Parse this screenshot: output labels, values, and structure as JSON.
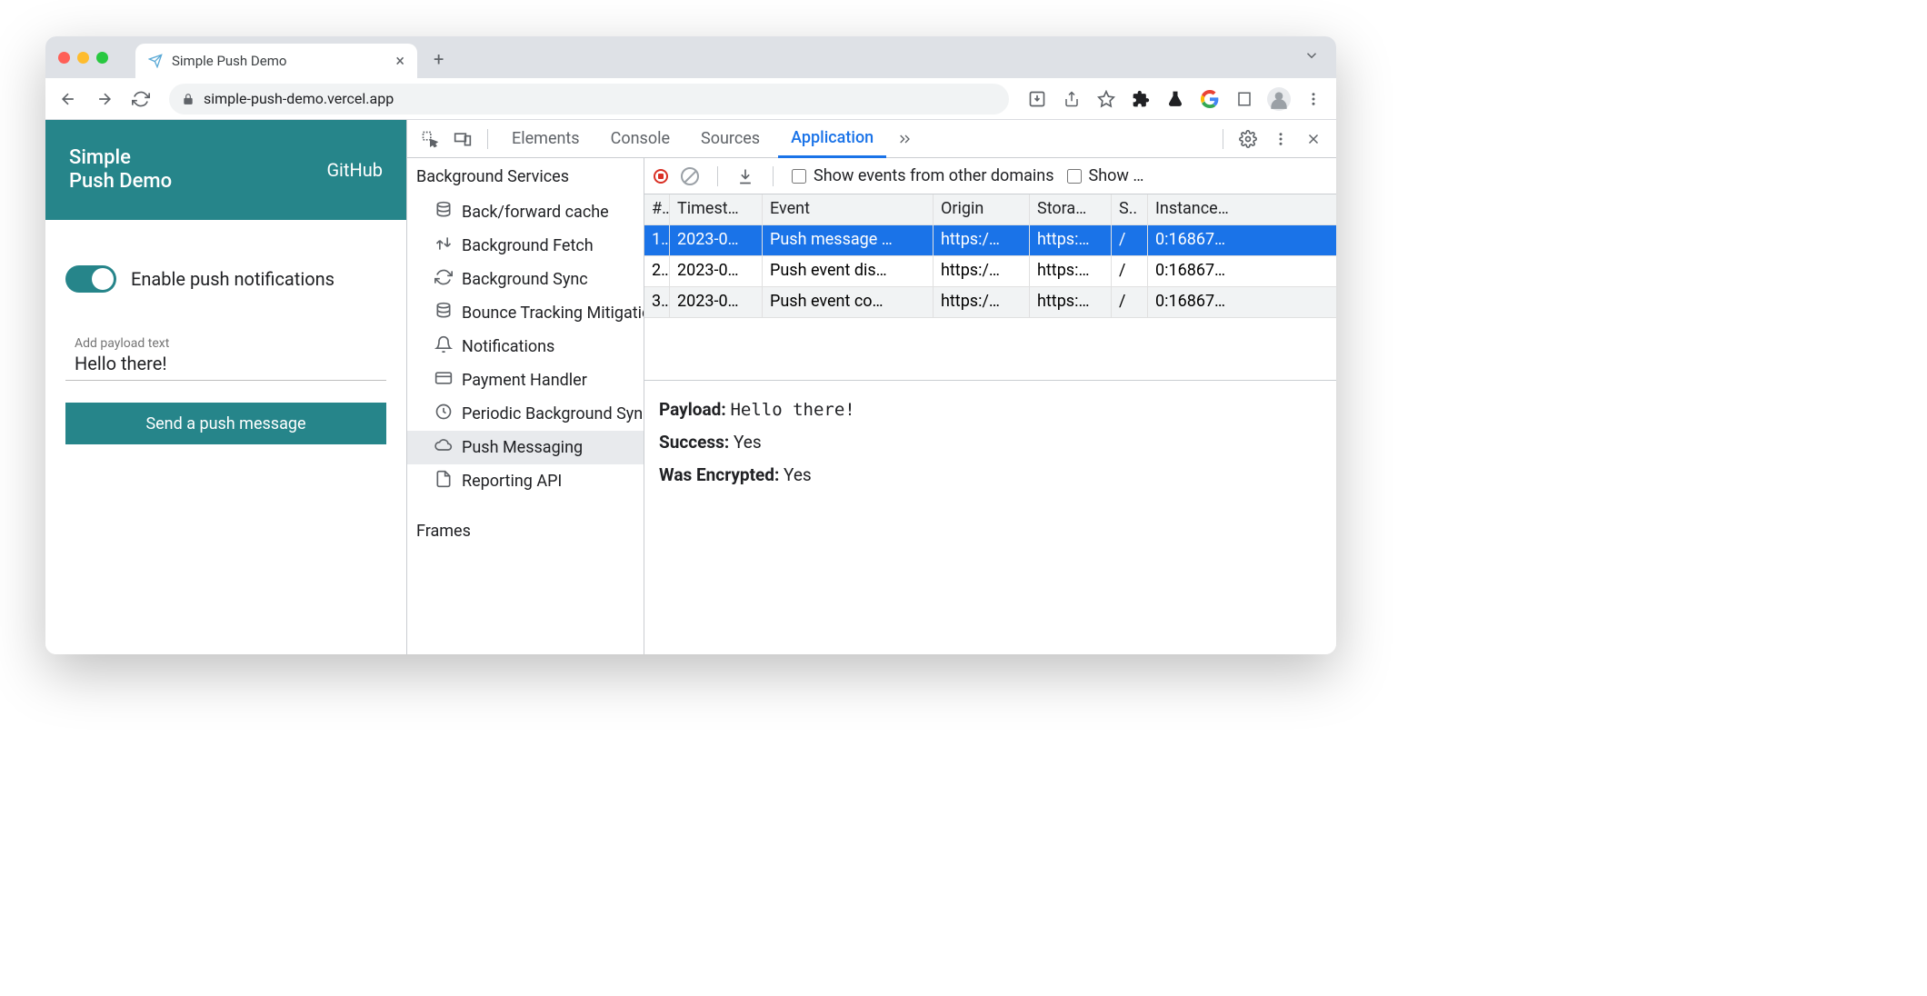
{
  "browser": {
    "tab_title": "Simple Push Demo",
    "url": "simple-push-demo.vercel.app"
  },
  "page": {
    "title_line1": "Simple",
    "title_line2": "Push Demo",
    "github_link": "GitHub",
    "toggle_label": "Enable push notifications",
    "toggle_on": true,
    "payload_label": "Add payload text",
    "payload_value": "Hello there!",
    "send_button": "Send a push message"
  },
  "devtools": {
    "tabs": [
      "Elements",
      "Console",
      "Sources",
      "Application"
    ],
    "active_tab": "Application",
    "sidebar": {
      "group": "Background Services",
      "items": [
        {
          "icon": "db",
          "label": "Back/forward cache"
        },
        {
          "icon": "updown",
          "label": "Background Fetch"
        },
        {
          "icon": "sync",
          "label": "Background Sync"
        },
        {
          "icon": "db",
          "label": "Bounce Tracking Mitigations"
        },
        {
          "icon": "bell",
          "label": "Notifications"
        },
        {
          "icon": "card",
          "label": "Payment Handler"
        },
        {
          "icon": "clock",
          "label": "Periodic Background Sync"
        },
        {
          "icon": "cloud",
          "label": "Push Messaging"
        },
        {
          "icon": "file",
          "label": "Reporting API"
        }
      ],
      "selected": "Push Messaging",
      "group2": "Frames"
    },
    "toolbar": {
      "chk1": "Show events from other domains",
      "chk2": "Show …"
    },
    "columns": [
      "#",
      "Timest…",
      "Event",
      "Origin",
      "Stora…",
      "S..",
      "Instance…"
    ],
    "rows": [
      {
        "idx": "1.",
        "ts": "2023-0…",
        "ev": "Push message …",
        "or": "https:/…",
        "st": "https:…",
        "sw": "/",
        "ins": "0:16867…"
      },
      {
        "idx": "2.",
        "ts": "2023-0…",
        "ev": "Push event dis…",
        "or": "https:/…",
        "st": "https:…",
        "sw": "/",
        "ins": "0:16867…"
      },
      {
        "idx": "3.",
        "ts": "2023-0…",
        "ev": "Push event co…",
        "or": "https:/…",
        "st": "https:…",
        "sw": "/",
        "ins": "0:16867…"
      }
    ],
    "selected_row": 0,
    "detail": {
      "payload_k": "Payload:",
      "payload_v": "Hello there!",
      "success_k": "Success:",
      "success_v": "Yes",
      "enc_k": "Was Encrypted:",
      "enc_v": "Yes"
    }
  }
}
